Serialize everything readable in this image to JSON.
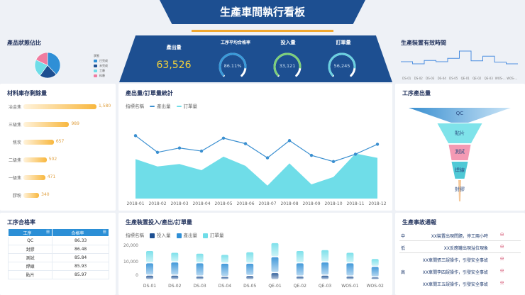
{
  "header": {
    "title": "生產車間執行看板"
  },
  "status_pie": {
    "title": "產品狀態佔比",
    "legend_title": "狀態",
    "items": [
      {
        "label": "已完成",
        "value": 38,
        "color": "#2f8fd6"
      },
      {
        "label": "未完成",
        "value": 22,
        "color": "#1d4f91"
      },
      {
        "label": "工廢",
        "value": 22,
        "color": "#6fdde8"
      },
      {
        "label": "料廢",
        "value": 18,
        "color": "#f07ca0"
      }
    ]
  },
  "kpi": {
    "output_label": "產出量",
    "output_value": "63,526",
    "pass_label": "工序平均合格率",
    "pass_value": "86.11%",
    "pass_fraction": 0.8611,
    "input_label": "投入量",
    "input_value": "33,121",
    "order_label": "訂單量",
    "order_value": "56,245"
  },
  "uptime": {
    "title": "生產裝置有效時間",
    "categories": [
      "DS-01",
      "DS-02",
      "DS-03",
      "DS-04",
      "DS-05",
      "QE-01",
      "QE-02",
      "QE-03",
      "WOS-...",
      "WOS-..."
    ],
    "values": [
      50,
      40,
      56,
      50,
      66,
      100,
      54,
      76,
      48,
      40
    ]
  },
  "inventory": {
    "title": "材料庫存剩餘量",
    "items": [
      {
        "label": "冶金焦",
        "value": 1580,
        "text": "1,580"
      },
      {
        "label": "三級焦",
        "value": 989,
        "text": "989"
      },
      {
        "label": "焦炭",
        "value": 657,
        "text": "657"
      },
      {
        "label": "二級焦",
        "value": 502,
        "text": "502"
      },
      {
        "label": "一級焦",
        "value": 471,
        "text": "471"
      },
      {
        "label": "膠粉",
        "value": 340,
        "text": "340"
      }
    ]
  },
  "chart_data": [
    {
      "type": "line",
      "title": "產出量/訂單量統計",
      "legend_title": "指標名稱",
      "categories": [
        "2018-01",
        "2018-02",
        "2018-03",
        "2018-04",
        "2018-05",
        "2018-06",
        "2018-07",
        "2018-08",
        "2018-09",
        "2018-10",
        "2018-11",
        "2018-12"
      ],
      "series": [
        {
          "name": "產出量",
          "values": [
            102,
            75,
            82,
            77,
            98,
            89,
            66,
            94,
            70,
            60,
            72,
            88
          ],
          "color": "#3a8fd0"
        },
        {
          "name": "訂單量",
          "values": [
            64,
            52,
            56,
            46,
            68,
            53,
            21,
            57,
            23,
            35,
            73,
            66
          ],
          "color": "#6fdde8"
        }
      ],
      "ylim": [
        0,
        115
      ]
    },
    {
      "type": "bar",
      "stacked": true,
      "title": "生產裝置投入/產出/訂單量",
      "legend_title": "指標名稱",
      "categories": [
        "DS-01",
        "DS-02",
        "DS-03",
        "DS-04",
        "DS-05",
        "QE-01",
        "QE-02",
        "QE-03",
        "WOS-01",
        "WOS-02"
      ],
      "series": [
        {
          "name": "投入量",
          "values": [
            2500,
            2500,
            2000,
            1800,
            2300,
            4000,
            2000,
            2500,
            2000,
            1500
          ],
          "color": "#1d4f91"
        },
        {
          "name": "產出量",
          "values": [
            7000,
            7500,
            7500,
            7500,
            7000,
            9000,
            7500,
            7500,
            7500,
            6000
          ],
          "color": "#2f8fd6"
        },
        {
          "name": "訂單量",
          "values": [
            7000,
            5500,
            5500,
            5000,
            6500,
            8000,
            7000,
            7000,
            6000,
            4500
          ],
          "color": "#6fdde8"
        }
      ],
      "yticks": [
        "20,000",
        "10,000",
        "0"
      ],
      "ylim": [
        0,
        22000
      ]
    }
  ],
  "funnel": {
    "title": "工序產出量",
    "items": [
      {
        "label": "QC",
        "color": "#3a8fd0"
      },
      {
        "label": "貼片",
        "color": "#7fe3ea"
      },
      {
        "label": "測試",
        "color": "#f49ab4"
      },
      {
        "label": "焊線",
        "color": "#4fc9d6"
      },
      {
        "label": "封膠",
        "color": "#f5c89a"
      }
    ]
  },
  "pass_table": {
    "title": "工序合格率",
    "columns": [
      "工序",
      "合格率"
    ],
    "rows": [
      [
        "QC",
        "86.33"
      ],
      [
        "封膠",
        "86.48"
      ],
      [
        "測試",
        "85.84"
      ],
      [
        "焊線",
        "85.93"
      ],
      [
        "貼片",
        "85.97"
      ]
    ]
  },
  "accidents": {
    "title": "生產事故通報",
    "rows": [
      {
        "level": "中",
        "text": "XX裝置出現問題，停工兩小時"
      },
      {
        "level": "低",
        "text": "XX反應罐出現溢位現象"
      },
      {
        "level": "高",
        "text": "XX車間張三誤操作，引發安全事故"
      },
      {
        "level": "",
        "text": "XX車間李四誤操作，引發安全事故"
      },
      {
        "level": "",
        "text": "XX車間王五誤操作，引發安全事故"
      }
    ]
  }
}
